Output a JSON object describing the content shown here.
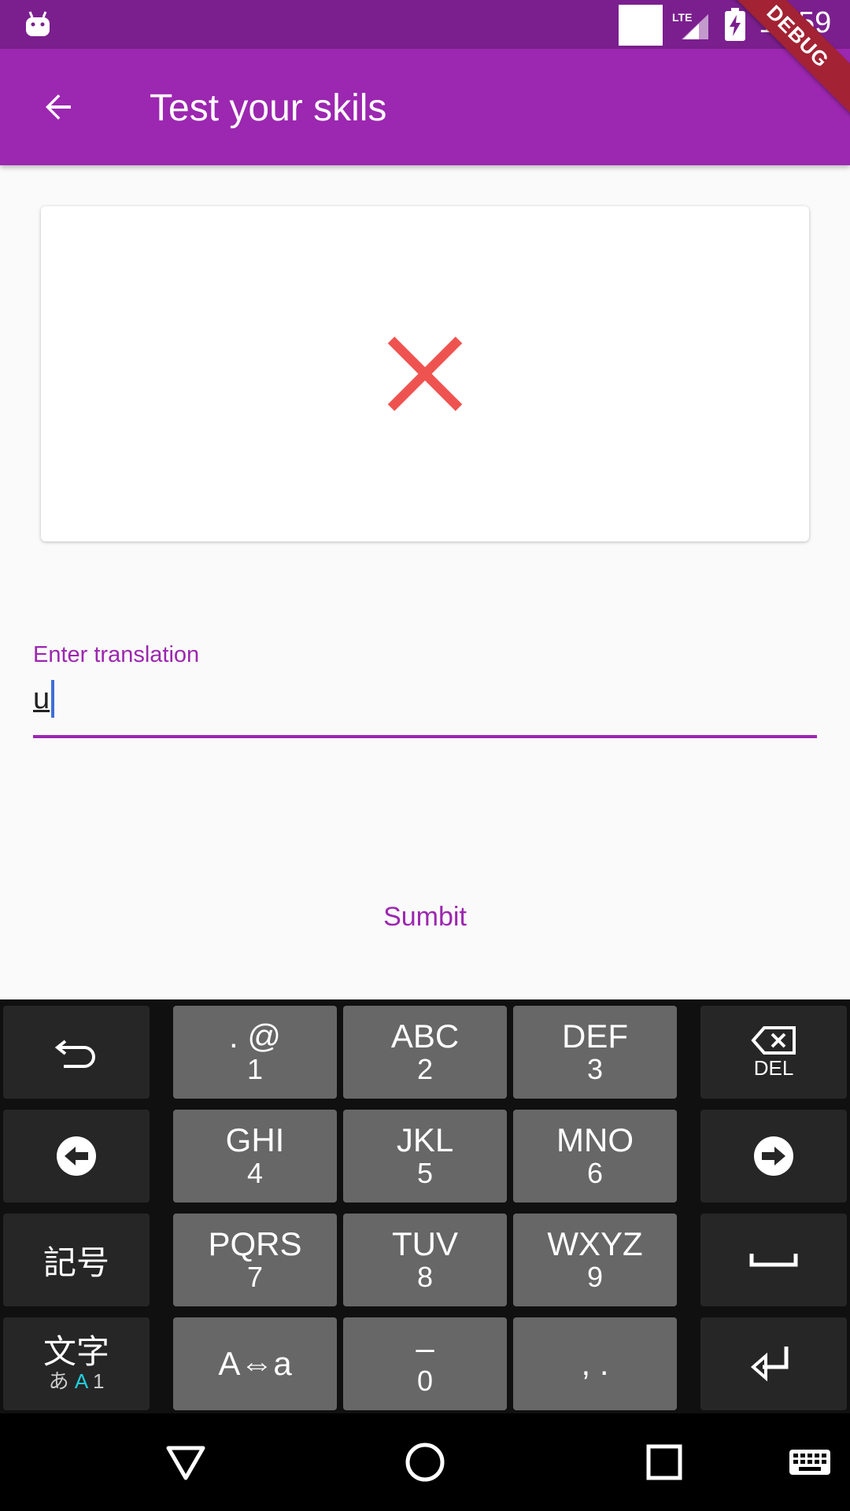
{
  "status_bar": {
    "time": "11:59",
    "network": "LTE"
  },
  "app_bar": {
    "title": "Test your skils"
  },
  "debug_banner": "DEBUG",
  "result_card": {
    "icon": "close-icon",
    "color": "#ef5350"
  },
  "translation_field": {
    "label": "Enter translation",
    "value": "u"
  },
  "submit_label": "Sumbit",
  "keyboard": {
    "keys": [
      {
        "name": "undo",
        "top": "",
        "bottom": ""
      },
      {
        "name": "key-1",
        "top": ". @",
        "bottom": "1"
      },
      {
        "name": "key-2",
        "top": "ABC",
        "bottom": "2"
      },
      {
        "name": "key-3",
        "top": "DEF",
        "bottom": "3"
      },
      {
        "name": "delete",
        "top": "",
        "bottom": "DEL"
      },
      {
        "name": "key-4",
        "top": "GHI",
        "bottom": "4"
      },
      {
        "name": "key-5",
        "top": "JKL",
        "bottom": "5"
      },
      {
        "name": "key-6",
        "top": "MNO",
        "bottom": "6"
      },
      {
        "name": "key-7",
        "top": "PQRS",
        "bottom": "7"
      },
      {
        "name": "key-8",
        "top": "TUV",
        "bottom": "8"
      },
      {
        "name": "key-9",
        "top": "WXYZ",
        "bottom": "9"
      },
      {
        "name": "key-0",
        "top": "–",
        "bottom": "0"
      },
      {
        "name": "punct",
        "top": "",
        "bottom": ", ."
      }
    ],
    "symbols_label": "記号",
    "char_mode_label": "文字",
    "char_mode_sub": [
      "あ",
      "A",
      "1"
    ],
    "case_toggle_label": "A⇔a"
  }
}
